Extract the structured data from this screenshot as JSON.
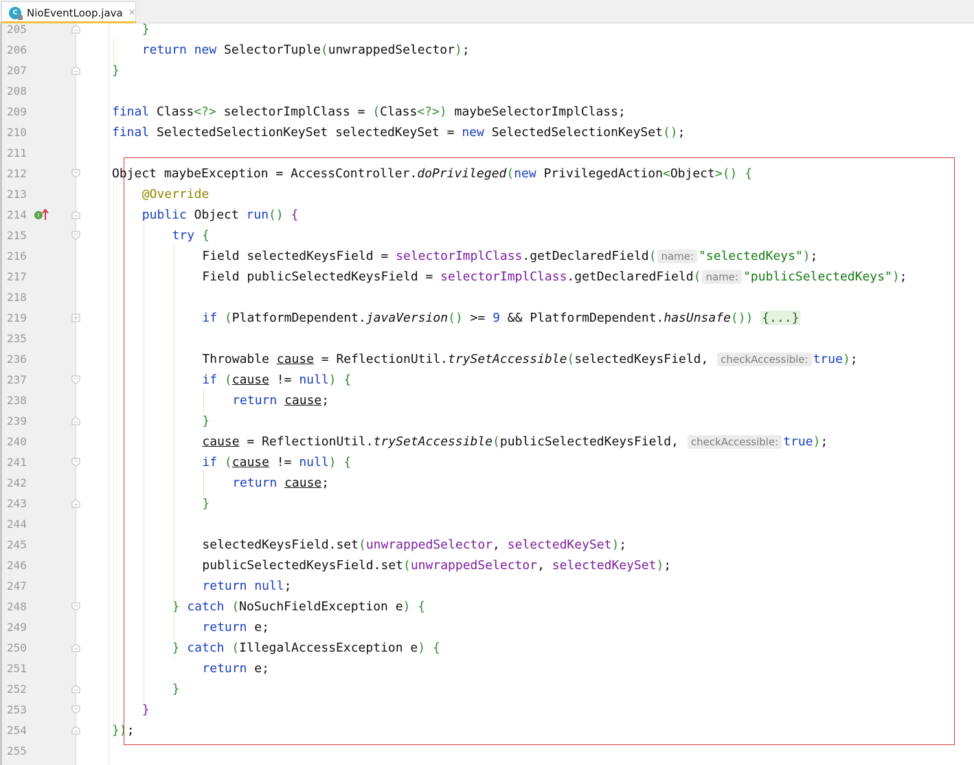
{
  "tab": {
    "file_icon_letter": "C",
    "title": "NioEventLoop.java",
    "close": "×"
  },
  "colors": {
    "keyword": "#1a3fc0",
    "string": "#137a13",
    "field": "#7a1fa0",
    "annotation": "#8a8a00",
    "highlight_border": "#d9363e",
    "tab_underline": "#f5c242"
  },
  "lines": [
    {
      "num": "205",
      "fold": "end",
      "indent": 2,
      "tokens": [
        [
          "}",
          "p"
        ]
      ]
    },
    {
      "num": "206",
      "indent": 2,
      "tokens": [
        [
          "return",
          "kw"
        ],
        [
          " ",
          ""
        ],
        [
          "new",
          "kw"
        ],
        [
          " SelectorTuple",
          ""
        ],
        [
          "(",
          "p"
        ],
        [
          "unwrappedSelector",
          ""
        ],
        [
          ")",
          "p"
        ],
        [
          ";",
          ""
        ]
      ]
    },
    {
      "num": "207",
      "fold": "end",
      "indent": 1,
      "tokens": [
        [
          "}",
          "p"
        ]
      ]
    },
    {
      "num": "208",
      "indent": 0,
      "tokens": []
    },
    {
      "num": "209",
      "indent": 1,
      "tokens": [
        [
          "final",
          "kw"
        ],
        [
          " Class",
          ""
        ],
        [
          "<?>",
          "p"
        ],
        [
          " selectorImplClass = ",
          ""
        ],
        [
          "(",
          "p"
        ],
        [
          "Class",
          ""
        ],
        [
          "<?>",
          "p"
        ],
        [
          ")",
          "p"
        ],
        [
          " maybeSelectorImplClass;",
          ""
        ]
      ]
    },
    {
      "num": "210",
      "indent": 1,
      "tokens": [
        [
          "final",
          "kw"
        ],
        [
          " SelectedSelectionKeySet selectedKeySet = ",
          ""
        ],
        [
          "new",
          "kw"
        ],
        [
          " SelectedSelectionKeySet",
          ""
        ],
        [
          "()",
          "p"
        ],
        [
          ";",
          ""
        ]
      ]
    },
    {
      "num": "211",
      "indent": 0,
      "tokens": []
    },
    {
      "num": "212",
      "fold": "start",
      "indent": 1,
      "tokens": [
        [
          "Object maybeException = AccessController.",
          ""
        ],
        [
          "doPrivileged",
          "it"
        ],
        [
          "(",
          "p"
        ],
        [
          "new",
          "kw"
        ],
        [
          " PrivilegedAction",
          ""
        ],
        [
          "<",
          "p"
        ],
        [
          "Object",
          ""
        ],
        [
          ">",
          "p"
        ],
        [
          "()",
          "p"
        ],
        [
          " ",
          ""
        ],
        [
          "{",
          "p"
        ]
      ]
    },
    {
      "num": "213",
      "indent": 2,
      "tokens": [
        [
          "@Override",
          "ann"
        ]
      ]
    },
    {
      "num": "214",
      "fold": "end",
      "marker": true,
      "indent": 2,
      "tokens": [
        [
          "public",
          "kw"
        ],
        [
          " Object ",
          ""
        ],
        [
          "run",
          "kw"
        ],
        [
          "()",
          "p"
        ],
        [
          " ",
          ""
        ],
        [
          "{",
          "fldp"
        ]
      ]
    },
    {
      "num": "215",
      "fold": "start",
      "indent": 3,
      "tokens": [
        [
          "try",
          "kw"
        ],
        [
          " ",
          ""
        ],
        [
          "{",
          "p"
        ]
      ]
    },
    {
      "num": "216",
      "indent": 4,
      "tokens": [
        [
          "Field selectedKeysField = ",
          ""
        ],
        [
          "selectorImplClass",
          "fld"
        ],
        [
          ".getDeclaredField",
          ""
        ],
        [
          "(",
          "p"
        ],
        [
          "name:",
          "hint"
        ],
        [
          "\"selectedKeys\"",
          "str"
        ],
        [
          ")",
          "p"
        ],
        [
          ";",
          ""
        ]
      ]
    },
    {
      "num": "217",
      "indent": 4,
      "tokens": [
        [
          "Field publicSelectedKeysField = ",
          ""
        ],
        [
          "selectorImplClass",
          "fld"
        ],
        [
          ".getDeclaredField",
          ""
        ],
        [
          "(",
          "p"
        ],
        [
          "name:",
          "hint"
        ],
        [
          "\"publicSelectedKeys\"",
          "str"
        ],
        [
          ")",
          "p"
        ],
        [
          ";",
          ""
        ]
      ]
    },
    {
      "num": "218",
      "indent": 0,
      "tokens": []
    },
    {
      "num": "219",
      "fold": "collapsed",
      "indent": 4,
      "tokens": [
        [
          "if",
          "kw"
        ],
        [
          " ",
          ""
        ],
        [
          "(",
          "p"
        ],
        [
          "PlatformDependent.",
          ""
        ],
        [
          "javaVersion",
          "it"
        ],
        [
          "()",
          "p"
        ],
        [
          " >= ",
          ""
        ],
        [
          "9",
          "num"
        ],
        [
          " && PlatformDependent.",
          ""
        ],
        [
          "hasUnsafe",
          "it"
        ],
        [
          "()",
          "p"
        ],
        [
          ")",
          "p"
        ],
        [
          " ",
          ""
        ],
        [
          "{...}",
          "folded"
        ]
      ]
    },
    {
      "num": "235",
      "indent": 0,
      "tokens": []
    },
    {
      "num": "236",
      "indent": 4,
      "tokens": [
        [
          "Throwable ",
          ""
        ],
        [
          "cause",
          "ul"
        ],
        [
          " = ReflectionUtil.",
          ""
        ],
        [
          "trySetAccessible",
          "it"
        ],
        [
          "(",
          "p"
        ],
        [
          "selectedKeysField, ",
          ""
        ],
        [
          "checkAccessible:",
          "hint"
        ],
        [
          "true",
          "kw"
        ],
        [
          ")",
          "p"
        ],
        [
          ";",
          ""
        ]
      ]
    },
    {
      "num": "237",
      "fold": "start",
      "indent": 4,
      "tokens": [
        [
          "if",
          "kw"
        ],
        [
          " ",
          ""
        ],
        [
          "(",
          "p"
        ],
        [
          "cause",
          "ul"
        ],
        [
          " != ",
          ""
        ],
        [
          "null",
          "kw"
        ],
        [
          ")",
          "p"
        ],
        [
          " ",
          ""
        ],
        [
          "{",
          "p"
        ]
      ]
    },
    {
      "num": "238",
      "indent": 5,
      "tokens": [
        [
          "return",
          "kw"
        ],
        [
          " ",
          ""
        ],
        [
          "cause",
          "ul"
        ],
        [
          ";",
          ""
        ]
      ]
    },
    {
      "num": "239",
      "fold": "end",
      "indent": 4,
      "tokens": [
        [
          "}",
          "p"
        ]
      ]
    },
    {
      "num": "240",
      "indent": 4,
      "tokens": [
        [
          "cause",
          "ul"
        ],
        [
          " = ReflectionUtil.",
          ""
        ],
        [
          "trySetAccessible",
          "it"
        ],
        [
          "(",
          "p"
        ],
        [
          "publicSelectedKeysField, ",
          ""
        ],
        [
          "checkAccessible:",
          "hint"
        ],
        [
          "true",
          "kw"
        ],
        [
          ")",
          "p"
        ],
        [
          ";",
          ""
        ]
      ]
    },
    {
      "num": "241",
      "fold": "start",
      "indent": 4,
      "tokens": [
        [
          "if",
          "kw"
        ],
        [
          " ",
          ""
        ],
        [
          "(",
          "p"
        ],
        [
          "cause",
          "ul"
        ],
        [
          " != ",
          ""
        ],
        [
          "null",
          "kw"
        ],
        [
          ")",
          "p"
        ],
        [
          " ",
          ""
        ],
        [
          "{",
          "p"
        ]
      ]
    },
    {
      "num": "242",
      "indent": 5,
      "tokens": [
        [
          "return",
          "kw"
        ],
        [
          " ",
          ""
        ],
        [
          "cause",
          "ul"
        ],
        [
          ";",
          ""
        ]
      ]
    },
    {
      "num": "243",
      "fold": "end",
      "indent": 4,
      "tokens": [
        [
          "}",
          "p"
        ]
      ]
    },
    {
      "num": "244",
      "indent": 0,
      "tokens": []
    },
    {
      "num": "245",
      "indent": 4,
      "tokens": [
        [
          "selectedKeysField.set",
          ""
        ],
        [
          "(",
          "p"
        ],
        [
          "unwrappedSelector",
          "fld"
        ],
        [
          ", ",
          ""
        ],
        [
          "selectedKeySet",
          "fld"
        ],
        [
          ")",
          "p"
        ],
        [
          ";",
          ""
        ]
      ]
    },
    {
      "num": "246",
      "indent": 4,
      "tokens": [
        [
          "publicSelectedKeysField.set",
          ""
        ],
        [
          "(",
          "p"
        ],
        [
          "unwrappedSelector",
          "fld"
        ],
        [
          ", ",
          ""
        ],
        [
          "selectedKeySet",
          "fld"
        ],
        [
          ")",
          "p"
        ],
        [
          ";",
          ""
        ]
      ]
    },
    {
      "num": "247",
      "indent": 4,
      "tokens": [
        [
          "return",
          "kw"
        ],
        [
          " ",
          ""
        ],
        [
          "null",
          "kw"
        ],
        [
          ";",
          ""
        ]
      ]
    },
    {
      "num": "248",
      "fold": "start",
      "indent": 3,
      "tokens": [
        [
          "}",
          "p"
        ],
        [
          " ",
          ""
        ],
        [
          "catch",
          "kw"
        ],
        [
          " ",
          ""
        ],
        [
          "(",
          "p"
        ],
        [
          "NoSuchFieldException e",
          ""
        ],
        [
          ")",
          "p"
        ],
        [
          " ",
          ""
        ],
        [
          "{",
          "p"
        ]
      ]
    },
    {
      "num": "249",
      "indent": 4,
      "tokens": [
        [
          "return",
          "kw"
        ],
        [
          " e;",
          ""
        ]
      ]
    },
    {
      "num": "250",
      "fold": "end",
      "indent": 3,
      "tokens": [
        [
          "}",
          "p"
        ],
        [
          " ",
          ""
        ],
        [
          "catch",
          "kw"
        ],
        [
          " ",
          ""
        ],
        [
          "(",
          "p"
        ],
        [
          "IllegalAccessException e",
          ""
        ],
        [
          ")",
          "p"
        ],
        [
          " ",
          ""
        ],
        [
          "{",
          "p"
        ]
      ]
    },
    {
      "num": "251",
      "indent": 4,
      "tokens": [
        [
          "return",
          "kw"
        ],
        [
          " e;",
          ""
        ]
      ]
    },
    {
      "num": "252",
      "fold": "end",
      "indent": 3,
      "tokens": [
        [
          "}",
          "p"
        ]
      ]
    },
    {
      "num": "253",
      "fold": "start",
      "indent": 2,
      "tokens": [
        [
          "}",
          "fldp"
        ]
      ]
    },
    {
      "num": "254",
      "fold": "end",
      "indent": 1,
      "tokens": [
        [
          "}",
          "p"
        ],
        [
          ")",
          "p"
        ],
        [
          ";",
          ""
        ]
      ]
    },
    {
      "num": "255",
      "indent": 0,
      "tokens": []
    }
  ]
}
